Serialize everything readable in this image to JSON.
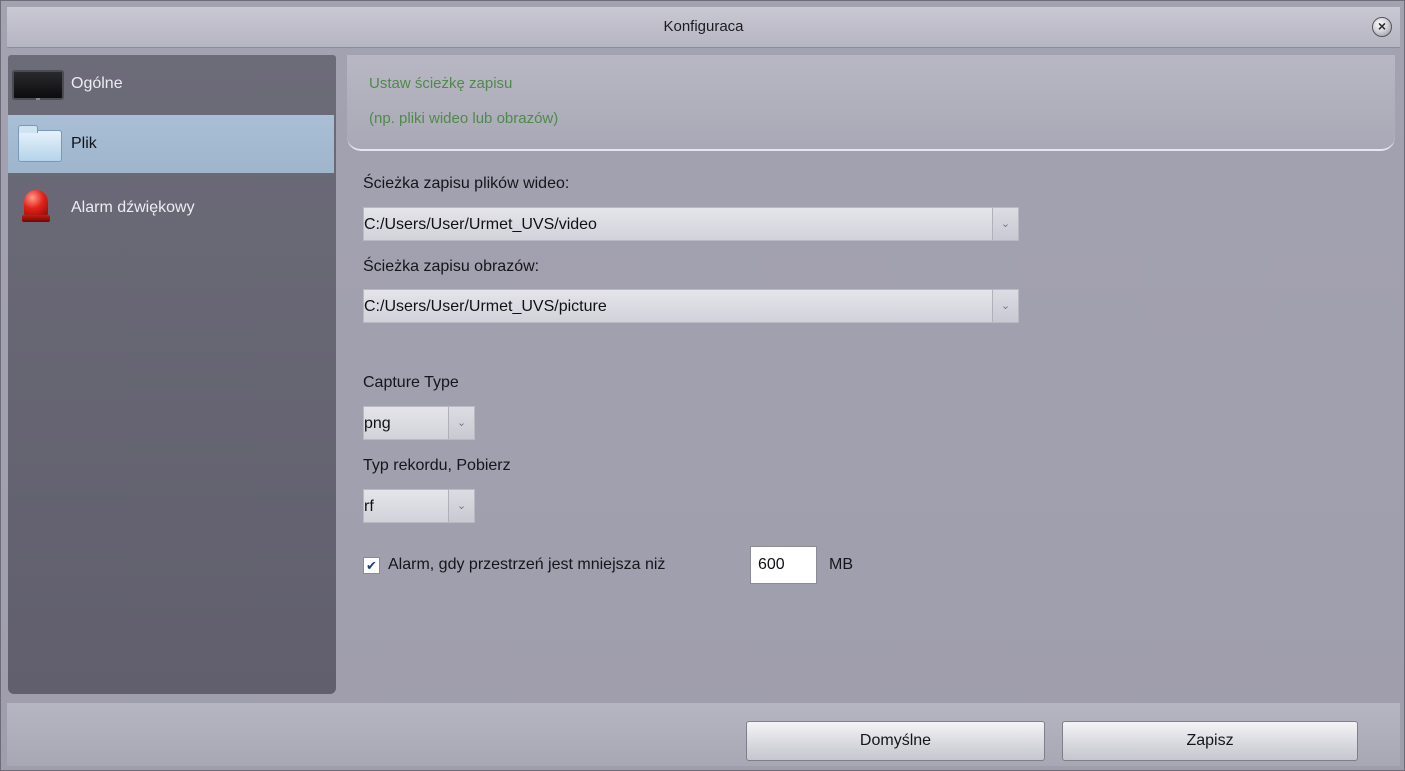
{
  "window": {
    "title": "Konfiguraca"
  },
  "sidebar": {
    "items": [
      {
        "label": "Ogólne",
        "icon": "monitor-icon",
        "active": false
      },
      {
        "label": "Plik",
        "icon": "folder-icon",
        "active": true
      },
      {
        "label": "Alarm dźwiękowy",
        "icon": "siren-icon",
        "active": false
      }
    ]
  },
  "header": {
    "line1": "Ustaw ścieżkę zapisu",
    "line2": "(np. pliki wideo lub obrazów)",
    "hint_color": "#4f8a4a"
  },
  "form": {
    "video_path_label": "Ścieżka zapisu plików wideo:",
    "video_path_value": "C:/Users/User/Urmet_UVS/video",
    "picture_path_label": "Ścieżka zapisu obrazów:",
    "picture_path_value": "C:/Users/User/Urmet_UVS/picture",
    "capture_type_label": "Capture Type",
    "capture_type_value": "png",
    "record_type_label": "Typ rekordu, Pobierz",
    "record_type_value": "rf",
    "alarm_checkbox_checked": true,
    "alarm_label": "Alarm, gdy przestrzeń jest mniejsza niż",
    "alarm_threshold": "600",
    "alarm_unit": "MB"
  },
  "footer": {
    "default_label": "Domyślne",
    "save_label": "Zapisz"
  },
  "colors": {
    "active_item": "#a9bfd6",
    "sidebar_bg": "#6c6b78",
    "window_bg": "#9f9eac"
  }
}
